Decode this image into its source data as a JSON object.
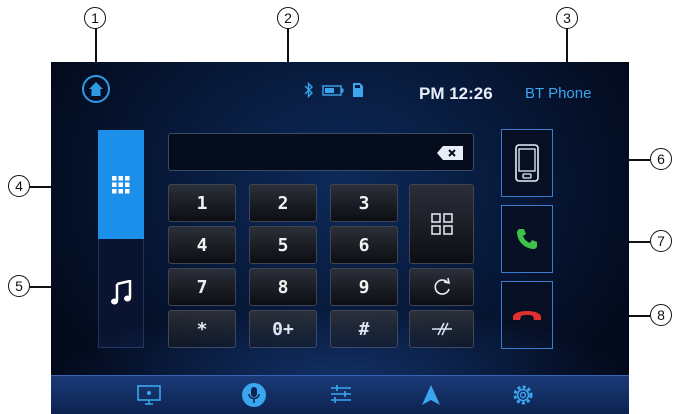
{
  "status": {
    "time": "PM 12:26",
    "mode": "BT Phone",
    "icons": [
      "bluetooth-icon",
      "battery-icon",
      "sd-card-icon"
    ]
  },
  "keypad": {
    "keys": [
      "1",
      "2",
      "3",
      "4",
      "5",
      "6",
      "7",
      "8",
      "9",
      "*",
      "0+",
      "#"
    ],
    "side_keys": [
      "grid-icon",
      "redial-icon",
      "delete-icon"
    ]
  },
  "tabs": [
    "keypad-tab",
    "music-tab"
  ],
  "call_buttons": [
    "phone-transfer-button",
    "call-button",
    "hangup-button"
  ],
  "bottom_icons": [
    "screen-icon",
    "mic-icon",
    "equalizer-icon",
    "navigation-icon",
    "settings-icon"
  ],
  "callouts": [
    "1",
    "2",
    "3",
    "4",
    "5",
    "6",
    "7",
    "8"
  ],
  "colors": {
    "accent": "#1b8fea",
    "call": "#3ec24a",
    "hangup": "#e0302f"
  }
}
